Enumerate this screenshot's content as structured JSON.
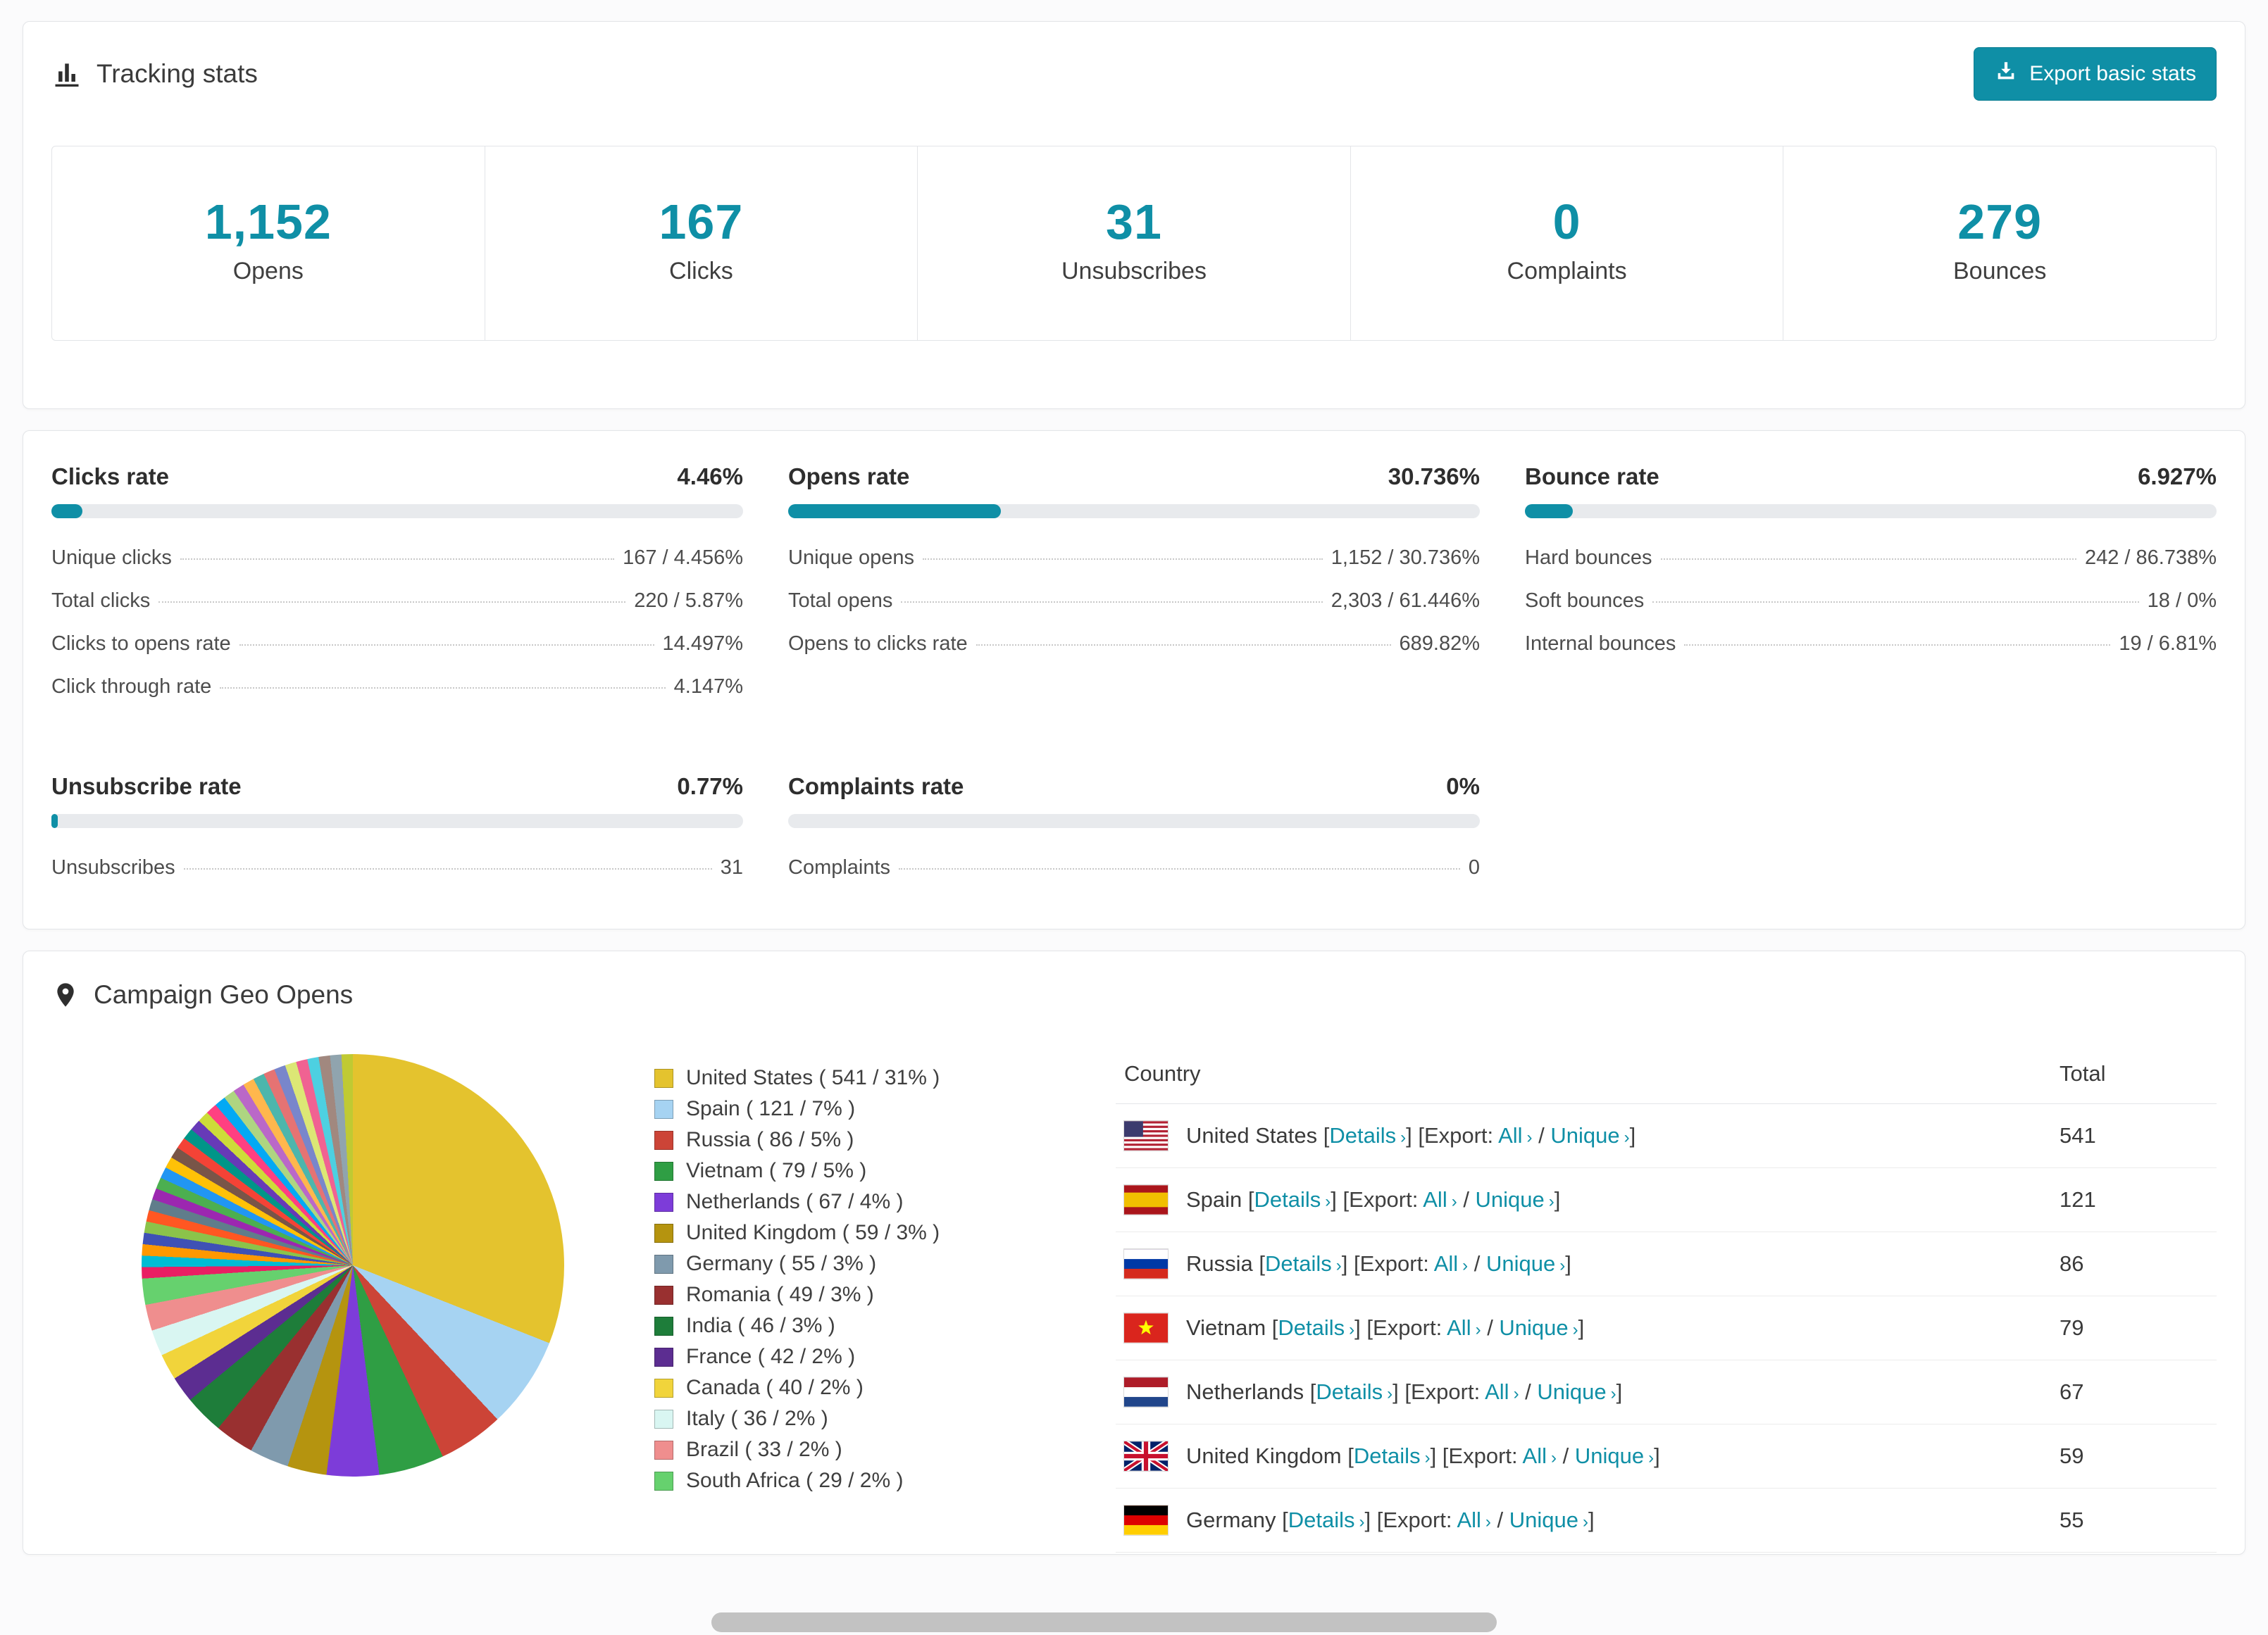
{
  "theme": {
    "accent": "#0F8FA6",
    "accent_dark": "#0C7E93",
    "bar_track": "#E8EAED",
    "card_border": "#E3E5E8"
  },
  "tracking": {
    "title": "Tracking stats",
    "export_button_label": "Export basic stats",
    "stats": [
      {
        "value": "1,152",
        "label": "Opens"
      },
      {
        "value": "167",
        "label": "Clicks"
      },
      {
        "value": "31",
        "label": "Unsubscribes"
      },
      {
        "value": "0",
        "label": "Complaints"
      },
      {
        "value": "279",
        "label": "Bounces"
      }
    ]
  },
  "rates": [
    {
      "title": "Clicks rate",
      "value": "4.46%",
      "percent": 4.46,
      "rows": [
        {
          "label": "Unique clicks",
          "value": "167 / 4.456%"
        },
        {
          "label": "Total clicks",
          "value": "220 / 5.87%"
        },
        {
          "label": "Clicks to opens rate",
          "value": "14.497%"
        },
        {
          "label": "Click through rate",
          "value": "4.147%"
        }
      ]
    },
    {
      "title": "Opens rate",
      "value": "30.736%",
      "percent": 30.736,
      "rows": [
        {
          "label": "Unique opens",
          "value": "1,152 / 30.736%"
        },
        {
          "label": "Total opens",
          "value": "2,303 / 61.446%"
        },
        {
          "label": "Opens to clicks rate",
          "value": "689.82%"
        }
      ]
    },
    {
      "title": "Bounce rate",
      "value": "6.927%",
      "percent": 6.927,
      "rows": [
        {
          "label": "Hard bounces",
          "value": "242 / 86.738%"
        },
        {
          "label": "Soft bounces",
          "value": "18 / 0%"
        },
        {
          "label": "Internal bounces",
          "value": "19 / 6.81%"
        }
      ]
    },
    {
      "title": "Unsubscribe rate",
      "value": "0.77%",
      "percent": 0.77,
      "rows": [
        {
          "label": "Unsubscribes",
          "value": "31"
        }
      ]
    },
    {
      "title": "Complaints rate",
      "value": "0%",
      "percent": 0,
      "rows": [
        {
          "label": "Complaints",
          "value": "0"
        }
      ]
    }
  ],
  "geo": {
    "title": "Campaign Geo Opens",
    "chart_data": {
      "type": "pie",
      "title": "Campaign Geo Opens",
      "slices": [
        {
          "label": "United States",
          "value": 541,
          "percent": 31,
          "color": "#E4C32E"
        },
        {
          "label": "Spain",
          "value": 121,
          "percent": 7,
          "color": "#A6D3F2"
        },
        {
          "label": "Russia",
          "value": 86,
          "percent": 5,
          "color": "#CC4437"
        },
        {
          "label": "Vietnam",
          "value": 79,
          "percent": 5,
          "color": "#2F9E44"
        },
        {
          "label": "Netherlands",
          "value": 67,
          "percent": 4,
          "color": "#7D3CD9"
        },
        {
          "label": "United Kingdom",
          "value": 59,
          "percent": 3,
          "color": "#B5940F"
        },
        {
          "label": "Germany",
          "value": 55,
          "percent": 3,
          "color": "#7F9AAD"
        },
        {
          "label": "Romania",
          "value": 49,
          "percent": 3,
          "color": "#993030"
        },
        {
          "label": "India",
          "value": 46,
          "percent": 3,
          "color": "#1E7D3A"
        },
        {
          "label": "France",
          "value": 42,
          "percent": 2,
          "color": "#5C2D91"
        },
        {
          "label": "Canada",
          "value": 40,
          "percent": 2,
          "color": "#F1D43B"
        },
        {
          "label": "Italy",
          "value": 36,
          "percent": 2,
          "color": "#D9F6F2"
        },
        {
          "label": "Brazil",
          "value": 33,
          "percent": 2,
          "color": "#EF8E8E"
        },
        {
          "label": "South Africa",
          "value": 29,
          "percent": 2,
          "color": "#66D16E"
        }
      ],
      "other_slices_percent_total": 26,
      "other_slice_colors": [
        "#E91E63",
        "#00BCD4",
        "#FF9800",
        "#3F51B5",
        "#8BC34A",
        "#FF5722",
        "#607D8B",
        "#9C27B0",
        "#4CAF50",
        "#2196F3",
        "#FFC107",
        "#795548",
        "#F44336",
        "#009688",
        "#673AB7",
        "#CDDC39",
        "#FF4081",
        "#03A9F4",
        "#AED581",
        "#BA68C8",
        "#FFB74D",
        "#4DB6AC",
        "#E57373",
        "#7986CB",
        "#DCE775",
        "#F06292",
        "#4DD0E1",
        "#A1887F",
        "#90A4AE",
        "#C0CA33"
      ]
    },
    "legend": [
      {
        "label": "United States ( 541 / 31% )",
        "color": "#E4C32E"
      },
      {
        "label": "Spain ( 121 / 7% )",
        "color": "#A6D3F2"
      },
      {
        "label": "Russia ( 86 / 5% )",
        "color": "#CC4437"
      },
      {
        "label": "Vietnam ( 79 / 5% )",
        "color": "#2F9E44"
      },
      {
        "label": "Netherlands ( 67 / 4% )",
        "color": "#7D3CD9"
      },
      {
        "label": "United Kingdom ( 59 / 3% )",
        "color": "#B5940F"
      },
      {
        "label": "Germany ( 55 / 3% )",
        "color": "#7F9AAD"
      },
      {
        "label": "Romania ( 49 / 3% )",
        "color": "#993030"
      },
      {
        "label": "India ( 46 / 3% )",
        "color": "#1E7D3A"
      },
      {
        "label": "France ( 42 / 2% )",
        "color": "#5C2D91"
      },
      {
        "label": "Canada ( 40 / 2% )",
        "color": "#F1D43B"
      },
      {
        "label": "Italy ( 36 / 2% )",
        "color": "#D9F6F2"
      },
      {
        "label": "Brazil ( 33 / 2% )",
        "color": "#EF8E8E"
      },
      {
        "label": "South Africa ( 29 / 2% )",
        "color": "#66D16E"
      }
    ],
    "table": {
      "country_header": "Country",
      "total_header": "Total",
      "details_label": "Details",
      "export_label": "Export: ",
      "all_label": "All",
      "unique_label": "Unique",
      "chevron": "›",
      "bracket_open": " [",
      "bracket_close_open": "] [",
      "bracket_close": "]",
      "separator": " / ",
      "rows": [
        {
          "country": "United States",
          "flag": "us",
          "total": "541"
        },
        {
          "country": "Spain",
          "flag": "es",
          "total": "121"
        },
        {
          "country": "Russia",
          "flag": "ru",
          "total": "86"
        },
        {
          "country": "Vietnam",
          "flag": "vn",
          "total": "79"
        },
        {
          "country": "Netherlands",
          "flag": "nl",
          "total": "67"
        },
        {
          "country": "United Kingdom",
          "flag": "gb",
          "total": "59"
        },
        {
          "country": "Germany",
          "flag": "de",
          "total": "55"
        }
      ]
    }
  }
}
